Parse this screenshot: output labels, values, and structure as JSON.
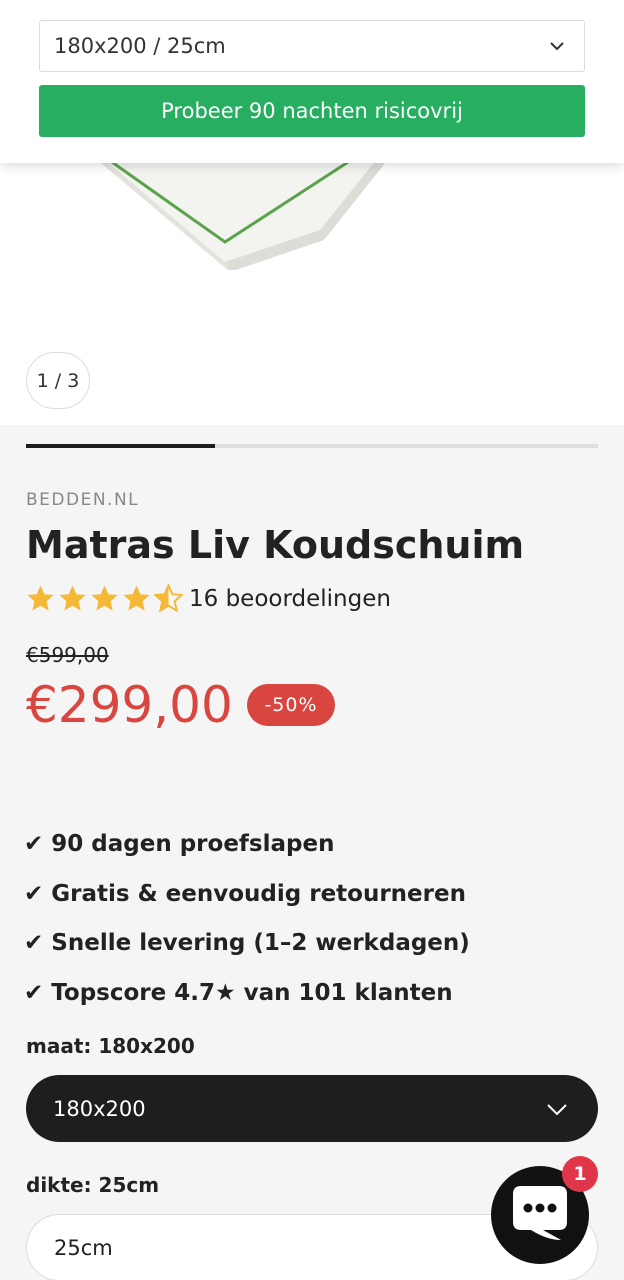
{
  "sticky": {
    "variant_value": "180x200 / 25cm",
    "cta_label": "Probeer 90 nachten risicovrij"
  },
  "gallery": {
    "counter": "1 / 3",
    "progress_fraction": 0.33
  },
  "product": {
    "vendor": "BEDDEN.NL",
    "title": "Matras Liv Koudschuim",
    "rating_value": 4.5,
    "rating_text": "16 beoordelingen",
    "old_price": "€599,00",
    "price": "€299,00",
    "discount_badge": "-50%"
  },
  "usps": [
    "✔ 90 dagen proefslapen",
    "✔ Gratis & eenvoudig retourneren",
    "✔ Snelle levering (1–2 werkdagen)",
    "✔ Topscore 4.7★ van 101 klanten"
  ],
  "options": {
    "size_label": "maat: 180x200",
    "size_value": "180x200",
    "thickness_label": "dikte: 25cm",
    "thickness_value": "25cm"
  },
  "chat": {
    "badge_count": "1"
  },
  "colors": {
    "cta_green": "#27ae60",
    "price_red": "#d9453f",
    "star_gold": "#f5b937",
    "dark": "#1e1e1e",
    "chat_badge": "#e0364a"
  },
  "icons": [
    "chevron-down-icon",
    "star-icon",
    "half-star-icon",
    "chat-bubble-icon",
    "check-icon"
  ]
}
